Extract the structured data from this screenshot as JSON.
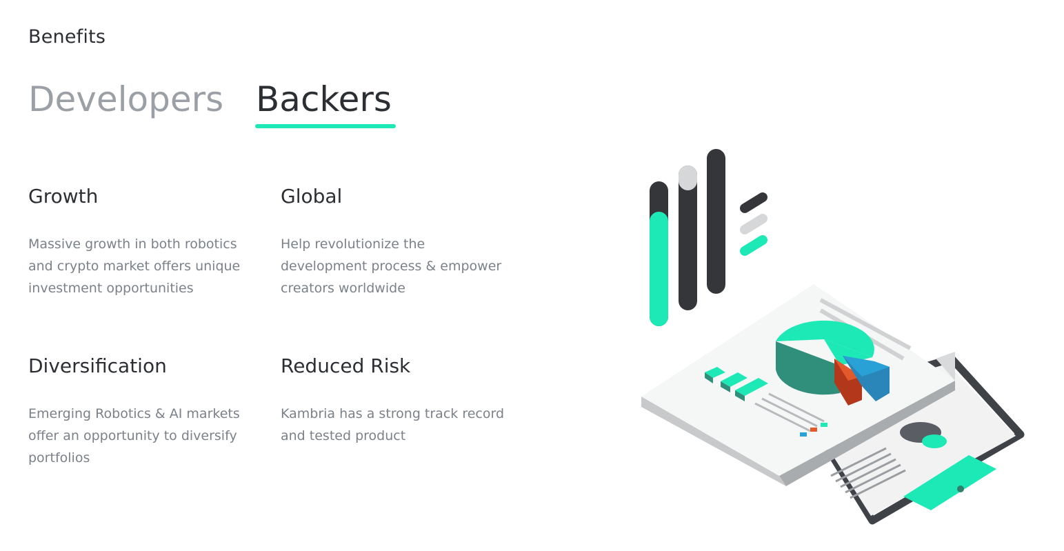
{
  "section": {
    "title": "Benefits"
  },
  "tabs": [
    {
      "label": "Developers",
      "active": false
    },
    {
      "label": "Backers",
      "active": true
    }
  ],
  "colors": {
    "accent": "#1de9b6",
    "dark": "#35363a",
    "muted_text": "#7b8189",
    "inactive_tab": "#9aa0a6",
    "chart_orange": "#e25a2b",
    "chart_blue": "#2aa1d6"
  },
  "benefits": [
    {
      "title": "Growth",
      "description": "Massive growth in both robotics and crypto market offers unique investment opportunities"
    },
    {
      "title": "Global",
      "description": "Help revolutionize the development process & empower creators worldwide"
    },
    {
      "title": "Diversification",
      "description": "Emerging Robotics & AI markets offer an opportunity to diversify portfolios"
    },
    {
      "title": "Reduced Risk",
      "description": "Kambria has a strong track record and tested product"
    }
  ],
  "illustration": {
    "icon": "isometric-analytics-report-illustration"
  }
}
